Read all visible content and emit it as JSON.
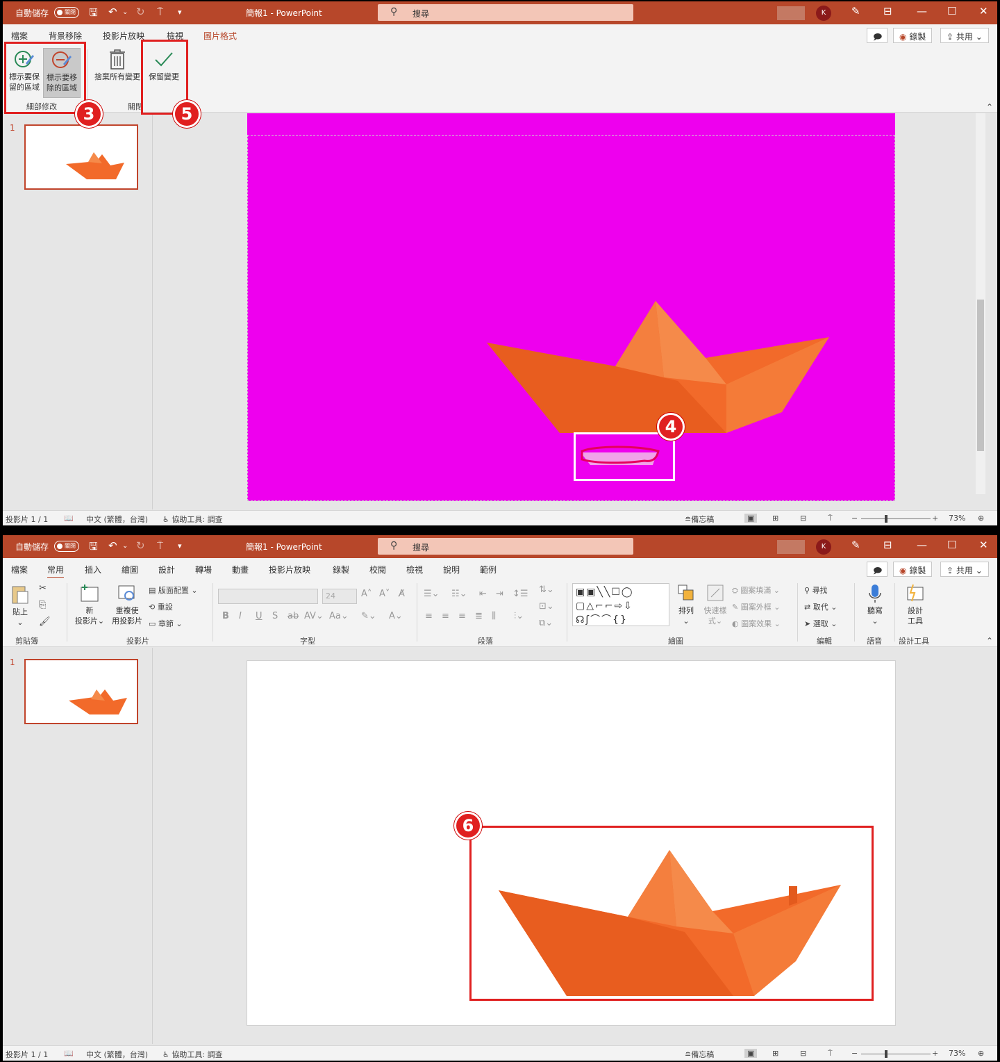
{
  "colors": {
    "accent": "#b7472a",
    "magenta": "#ee00ee",
    "callout": "#e02020",
    "boat": "#f26a2a"
  },
  "top": {
    "title": {
      "autosave": "自動儲存",
      "toggle": "關閉",
      "doc": "簡報1  -  PowerPoint",
      "search": "搜尋",
      "avatar": "K"
    },
    "tabs": {
      "file": "檔案",
      "bgremove": "背景移除",
      "slideshow": "投影片放映",
      "view": "檢視",
      "picfmt": "圖片格式"
    },
    "right": {
      "record": "錄製",
      "share": "共用"
    },
    "ribbon": {
      "keep": "標示要保留的區域",
      "keep1": "標示要保",
      "keep2": "留的區域",
      "remove1": "標示要移",
      "remove2": "除的區域",
      "discard": "捨棄所有變更",
      "keepchanges": "保留變更",
      "group_refine": "細部修改",
      "group_close": "關閉"
    },
    "slide_num": "1",
    "badges": {
      "b3": "3",
      "b4": "4",
      "b5": "5"
    },
    "status": {
      "slide": "投影片 1 / 1",
      "lang": "中文 (繁體，台灣)",
      "access": "協助工具: 調查",
      "notes": "備忘稿",
      "zoom": "73%"
    }
  },
  "bottom": {
    "title": {
      "autosave": "自動儲存",
      "toggle": "關閉",
      "doc": "簡報1  -  PowerPoint",
      "search": "搜尋",
      "avatar": "K"
    },
    "tabs": {
      "file": "檔案",
      "home": "常用",
      "insert": "插入",
      "draw": "繪圖",
      "design": "設計",
      "transitions": "轉場",
      "animations": "動畫",
      "slideshow": "投影片放映",
      "record": "錄製",
      "review": "校閱",
      "view": "檢視",
      "help": "說明",
      "example": "範例"
    },
    "right": {
      "record": "錄製",
      "share": "共用"
    },
    "ribbon": {
      "paste": "貼上",
      "new_slide1": "新",
      "new_slide2": "投影片",
      "reuse1": "重複使",
      "reuse2": "用投影片",
      "layout": "版面配置",
      "reset": "重設",
      "section": "章節",
      "font_size": "24",
      "arrange": "排列",
      "quickstyle1": "快速樣",
      "quickstyle2": "式",
      "shape_fill": "圖案填滿",
      "shape_outline": "圖案外框",
      "shape_effects": "圖案效果",
      "find": "尋找",
      "replace": "取代",
      "select": "選取",
      "dictate": "聽寫",
      "designer1": "設計",
      "designer2": "工具",
      "groups": {
        "clipboard": "剪貼簿",
        "slides": "投影片",
        "font": "字型",
        "paragraph": "段落",
        "drawing": "繪圖",
        "editing": "編輯",
        "voice": "語音",
        "designer": "設計工具"
      }
    },
    "slide_num": "1",
    "badges": {
      "b6": "6"
    },
    "status": {
      "slide": "投影片 1 / 1",
      "lang": "中文 (繁體，台灣)",
      "access": "協助工具: 調查",
      "notes": "備忘稿",
      "zoom": "73%"
    }
  }
}
